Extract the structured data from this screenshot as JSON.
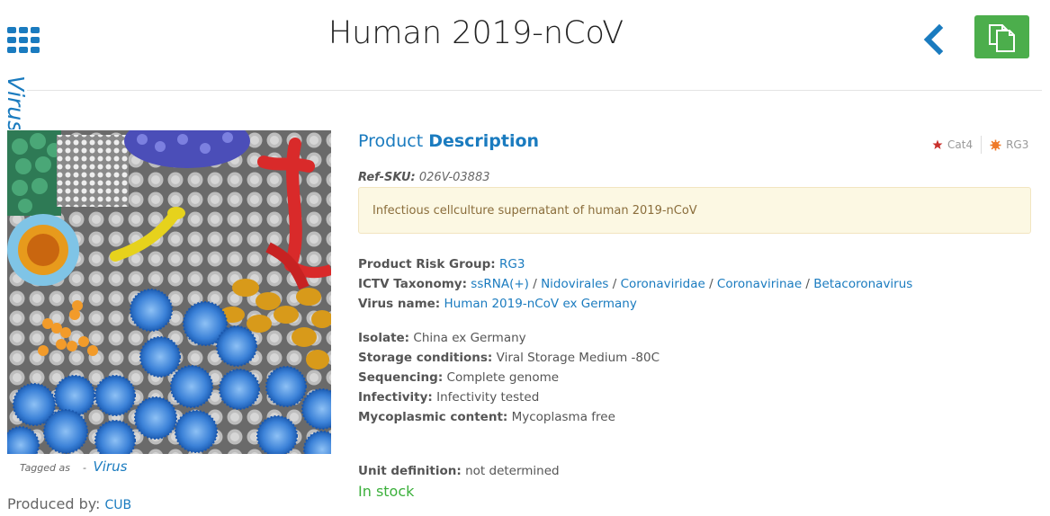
{
  "header": {
    "title": "Human 2019-nCoV",
    "vertical_label": "Virus",
    "back_icon": "chevron-left-icon",
    "copy_icon": "copy-icon",
    "copy_button_color": "#4cae4c",
    "accent_color": "#1a7bbf"
  },
  "sidebar": {
    "tagged_as_label": "Tagged as",
    "tag_separator": "-",
    "tag": "Virus",
    "produced_by_label": "Produced by:",
    "producer": "CUB"
  },
  "product": {
    "title_prefix": "Product",
    "title_emphasis": "Description",
    "badges": [
      {
        "icon": "star-icon",
        "label": "Cat4",
        "color": "#c9302c"
      },
      {
        "icon": "biohazard-icon",
        "label": "RG3",
        "color": "#ef7b2a"
      }
    ],
    "ref_sku_label": "Ref-SKU:",
    "ref_sku": "026V-03883",
    "summary": "Infectious cellculture supernatant of human 2019-nCoV",
    "risk_group_label": "Product Risk Group:",
    "risk_group": "RG3",
    "taxonomy_label": "ICTV Taxonomy:",
    "taxonomy": [
      "ssRNA(+)",
      "Nidovirales",
      "Coronaviridae",
      "Coronavirinae",
      "Betacoronavirus"
    ],
    "taxonomy_separator": " / ",
    "virus_name_label": "Virus name:",
    "virus_name": "Human 2019-nCoV ex Germany",
    "isolate_label": "Isolate:",
    "isolate": "China ex Germany",
    "storage_label": "Storage conditions:",
    "storage": "Viral Storage Medium -80C",
    "sequencing_label": "Sequencing:",
    "sequencing": "Complete genome",
    "infectivity_label": "Infectivity:",
    "infectivity": "Infectivity tested",
    "mycoplasmic_label": "Mycoplasmic content:",
    "mycoplasmic": "Mycoplasma free",
    "unit_label": "Unit definition:",
    "unit": "not determined",
    "stock_status": "In stock",
    "stock_color": "#3cb03c"
  }
}
